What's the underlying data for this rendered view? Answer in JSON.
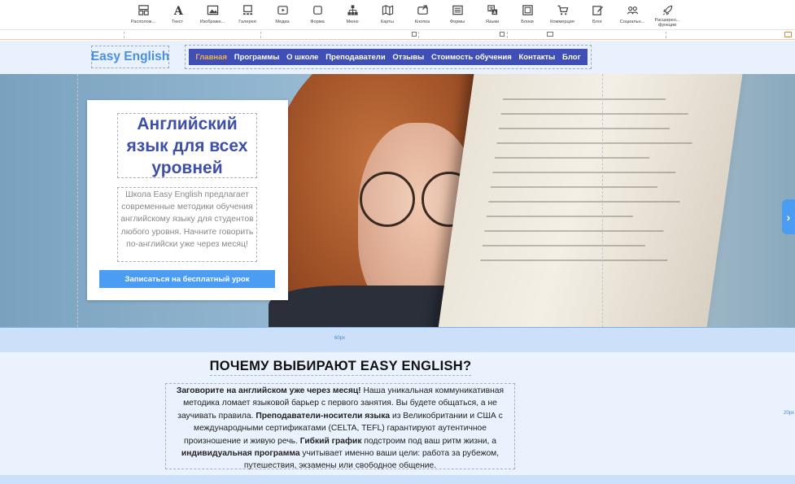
{
  "toolbar": {
    "items": [
      {
        "label": "Располож...",
        "icon": "layout-icon"
      },
      {
        "label": "Текст",
        "icon": "text-icon"
      },
      {
        "label": "Изображе...",
        "icon": "image-icon"
      },
      {
        "label": "Галерея",
        "icon": "gallery-icon"
      },
      {
        "label": "Медиа",
        "icon": "media-icon"
      },
      {
        "label": "Форма",
        "icon": "shape-icon"
      },
      {
        "label": "Меню",
        "icon": "menu-icon"
      },
      {
        "label": "Карты",
        "icon": "map-icon"
      },
      {
        "label": "Кнопка",
        "icon": "button-icon"
      },
      {
        "label": "Формы",
        "icon": "form-icon"
      },
      {
        "label": "Языки",
        "icon": "language-icon"
      },
      {
        "label": "Блоки",
        "icon": "blocks-icon"
      },
      {
        "label": "Коммерция",
        "icon": "cart-icon"
      },
      {
        "label": "Блог",
        "icon": "blog-icon"
      },
      {
        "label": "Социальн...",
        "icon": "social-icon"
      },
      {
        "label": "Расширен... функции",
        "icon": "rocket-icon"
      }
    ]
  },
  "header": {
    "logo": "Easy English",
    "nav": [
      {
        "label": "Главная",
        "active": true
      },
      {
        "label": "Программы",
        "active": false
      },
      {
        "label": "О школе",
        "active": false
      },
      {
        "label": "Преподаватели",
        "active": false
      },
      {
        "label": "Отзывы",
        "active": false
      },
      {
        "label": "Стоимость обучения",
        "active": false
      },
      {
        "label": "Контакты",
        "active": false
      },
      {
        "label": "Блог",
        "active": false
      }
    ]
  },
  "hero": {
    "title": "Английский язык для всех уровней",
    "text": "Школа Easy English предлагает современные методики обучения английскому языку для студентов любого уровня. Начните говорить по-английски уже через месяц!",
    "button": "Записаться на бесплатный урок",
    "handle": "›"
  },
  "spacer": {
    "label": "60px"
  },
  "why": {
    "title": "ПОЧЕМУ ВЫБИРАЮТ EASY ENGLISH?",
    "p1_bold": "Заговорите на английском уже через месяц!",
    "p1_text": " Наша уникальная коммуникативная методика ломает языковой барьер с первого занятия. Вы будете общаться, а не заучивать правила. ",
    "p2_bold": "Преподаватели-носители языка",
    "p2_text": " из Великобритании и США с международными сертификатами (CELTA, TEFL) гарантируют аутентичное произношение и живую речь. ",
    "p3_bold": "Гибкий график",
    "p3_text": " подстроим под ваш ритм жизни, а ",
    "p4_bold": "индивидуальная программа",
    "p4_text": " учитывает именно ваши цели: работа за рубежом, путешествия, экзамены или свободное общение.",
    "pad_label": "20px"
  },
  "colors": {
    "nav_bg": "#3f4fb5",
    "nav_active": "#f2b34a",
    "accent": "#4a9df2",
    "title": "#3d4fa8"
  }
}
